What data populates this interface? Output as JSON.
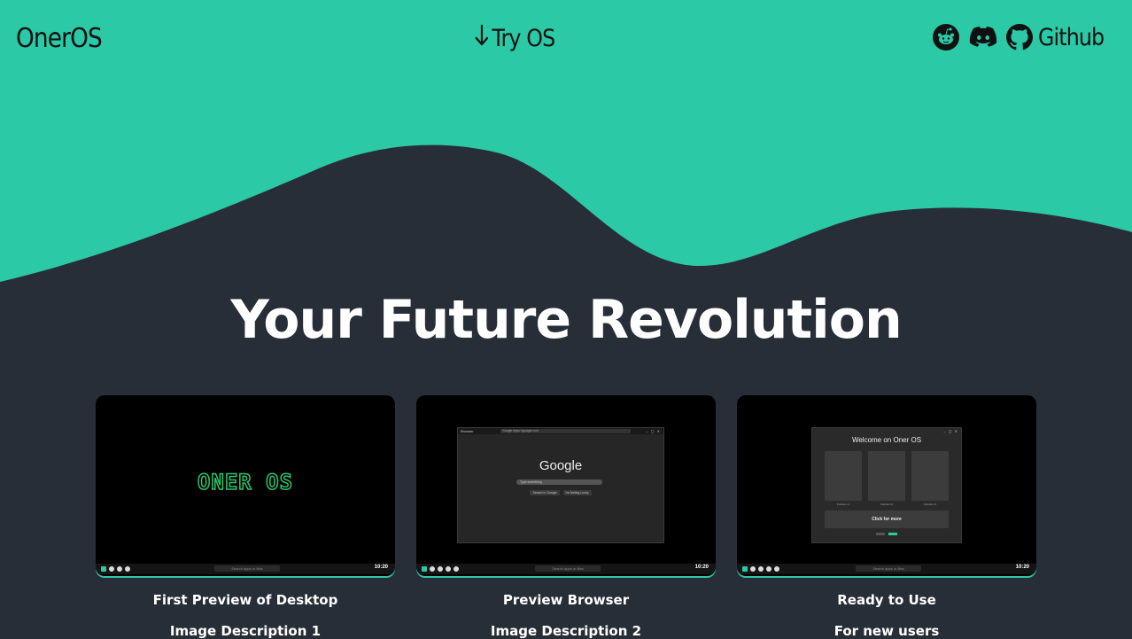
{
  "colors": {
    "accent": "#2bc9a6",
    "background": "#272e38",
    "nav_text": "#111111",
    "text": "#ffffff"
  },
  "nav": {
    "brand": "OnerOS",
    "try_label": "Try OS",
    "try_icon": "arrow-down-icon",
    "socials": [
      {
        "name": "reddit",
        "icon": "reddit-icon"
      },
      {
        "name": "discord",
        "icon": "discord-icon"
      },
      {
        "name": "github",
        "icon": "github-icon",
        "label": "Github"
      }
    ]
  },
  "hero": {
    "headline": "Your Future Revolution"
  },
  "cards": [
    {
      "title": "First Preview of Desktop",
      "description": "Image Description 1",
      "preview": {
        "logo_text": "ONER OS",
        "search_placeholder": "Search apps or files",
        "time": "10:20"
      }
    },
    {
      "title": "Preview Browser",
      "description": "Image Description 2",
      "preview": {
        "app_name": "Browser",
        "tab_title": "Google",
        "url": "https://google.com",
        "logo": "Google",
        "search_placeholder": "Type something",
        "buttons": [
          "Search in Google",
          "I'm feeling Lucky"
        ],
        "taskbar_search": "Search apps or files",
        "time": "10:20"
      }
    },
    {
      "title": "Ready to Use",
      "description": "For new users",
      "preview": {
        "window_title": "Welcome on Oner OS",
        "features": [
          "Function 1",
          "Function 2",
          "Function 3"
        ],
        "more_label": "Click for more",
        "buttons": [
          "back",
          "Next"
        ],
        "taskbar_search": "Search apps or files",
        "time": "10:20"
      }
    }
  ]
}
